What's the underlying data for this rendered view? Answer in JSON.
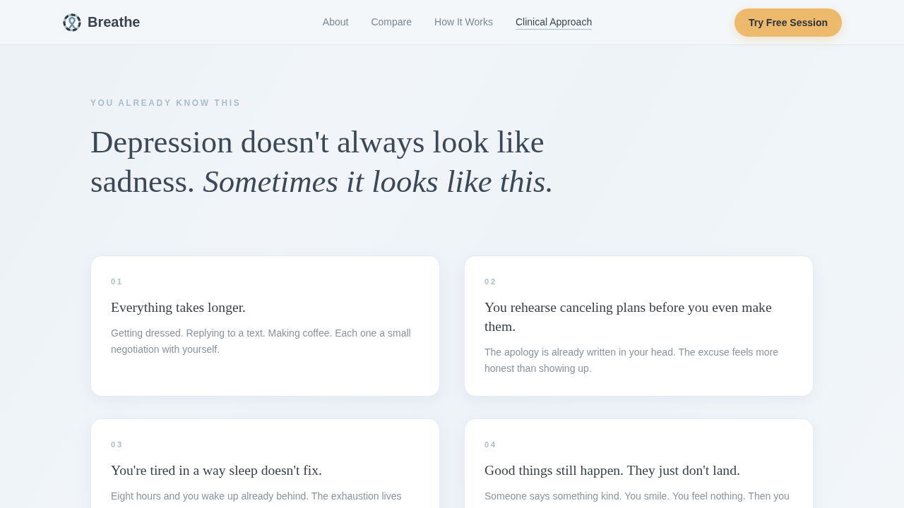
{
  "header": {
    "brand": "Breathe",
    "nav": [
      {
        "label": "About",
        "selected": false
      },
      {
        "label": "Compare",
        "selected": false
      },
      {
        "label": "How It Works",
        "selected": false
      },
      {
        "label": "Clinical Approach",
        "selected": true
      }
    ],
    "cta": "Try Free Session"
  },
  "hero": {
    "eyebrow": "YOU ALREADY KNOW THIS",
    "heading": "Depression doesn't always look like sadness. *Sometimes it looks like this.*"
  },
  "cards": [
    {
      "number": "01",
      "title": "Everything takes longer.",
      "body": "Getting dressed. Replying to a text. Making coffee. Each one a small negotiation with yourself."
    },
    {
      "number": "02",
      "title": "You rehearse canceling plans before you even make them.",
      "body": "The apology is already written in your head. The excuse feels more honest than showing up."
    },
    {
      "number": "03",
      "title": "You're tired in a way sleep doesn't fix.",
      "body": "Eight hours and you wake up already behind. The exhaustion lives"
    },
    {
      "number": "04",
      "title": "Good things still happen. They just don't land.",
      "body": "Someone says something kind. You smile. You feel nothing. Then you"
    }
  ]
}
